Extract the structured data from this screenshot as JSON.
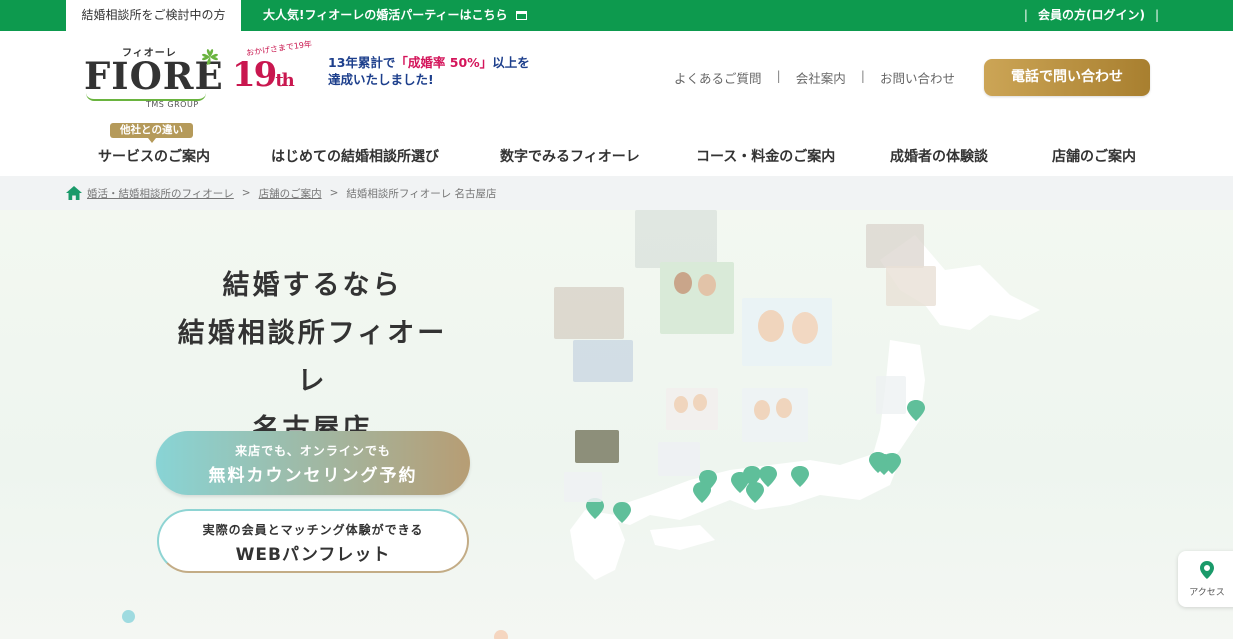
{
  "topbar": {
    "active_tab": "結婚相談所をご検討中の方",
    "party_link": "大人気!フィオーレの婚活パーティーはこちら",
    "login": "会員の方(ログイン)"
  },
  "logo": {
    "kana": "フィオーレ",
    "word": "FIORE",
    "group": "TMS GROUP"
  },
  "anniversary": {
    "arc": "おかげさまで19年",
    "number": "19",
    "suffix": "th"
  },
  "catch": {
    "line1_pre": "13年累計で",
    "line1_hl": "「成婚率 50%」",
    "line1_post": "以上を",
    "line2": "達成いたしました!"
  },
  "header_links": [
    "よくあるご質問",
    "会社案内",
    "お問い合わせ"
  ],
  "tel_button": "電話で問い合わせ",
  "nav": {
    "badge": "他社との違い",
    "items": [
      "サービスのご案内",
      "はじめての結婚相談所選び",
      "数字でみるフィオーレ",
      "コース・料金のご案内",
      "成婚者の体験談",
      "店舗のご案内"
    ]
  },
  "breadcrumb": [
    "婚活・結婚相談所のフィオーレ",
    "店舗のご案内",
    "結婚相談所フィオーレ 名古屋店"
  ],
  "hero": {
    "title_lines": [
      "結婚するなら",
      "結婚相談所フィオーレ",
      "名古屋店"
    ],
    "btn1_small": "来店でも、オンラインでも",
    "btn1_large": "無料カウンセリング予約",
    "btn2_small": "実際の会員とマッチング体験ができる",
    "btn2_large": "WEBパンフレット"
  },
  "access": {
    "label": "アクセス",
    "icon": "map-pin-icon"
  },
  "colors": {
    "brand_green": "#0d9a4e",
    "gold": "#b59a5a",
    "pink": "#d4145a",
    "navy": "#1d3f8c",
    "teal": "#5fbf9a"
  }
}
